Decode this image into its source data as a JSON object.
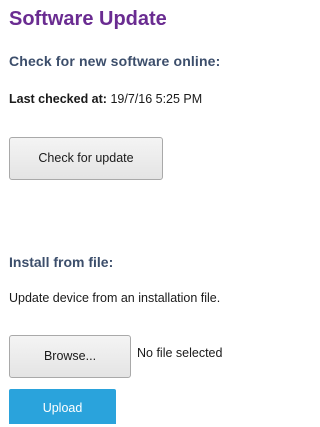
{
  "page": {
    "title": "Software Update"
  },
  "check_section": {
    "heading": "Check for new software online:",
    "last_checked_label": "Last checked at:",
    "last_checked_value": "19/7/16 5:25 PM",
    "check_button_label": "Check for update"
  },
  "install_section": {
    "heading": "Install from file:",
    "description": "Update device from an installation file.",
    "browse_button_label": "Browse...",
    "file_status": "No file selected",
    "upload_button_label": "Upload"
  },
  "colors": {
    "title": "#6a2c91",
    "section_heading": "#3c4e6b",
    "upload_button": "#2aa3dc"
  }
}
